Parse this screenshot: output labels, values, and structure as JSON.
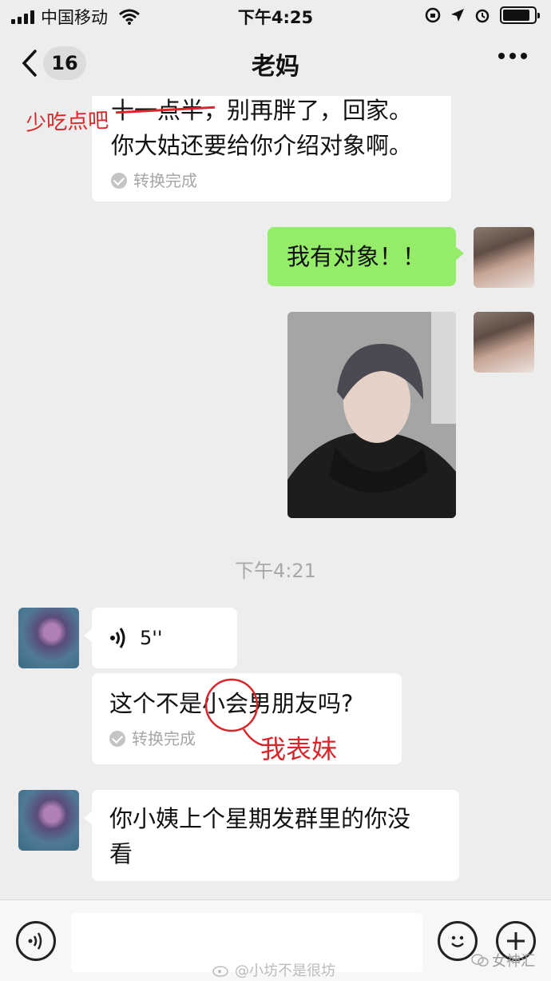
{
  "status_bar": {
    "carrier": "中国移动",
    "time": "下午4:25"
  },
  "nav": {
    "unread_count": "16",
    "title": "老妈"
  },
  "messages": {
    "mom_text_1": {
      "line1": "十一点半，别再胖了，回家。",
      "line2": "你大姑还要给你介绍对象啊。",
      "convert_status": "转换完成"
    },
    "me_text": "我有对象！！",
    "time_divider": "下午4:21",
    "mom_voice_duration": "5''",
    "mom_voice_transcript": {
      "text": "这个不是小会男朋友吗?",
      "convert_status": "转换完成"
    },
    "mom_text_2": {
      "line1": "你小姨上个星期发群里的你没",
      "line2": "看"
    }
  },
  "annotations": {
    "eat_less": "少吃点吧",
    "my_cousin": "我表妹"
  },
  "watermarks": {
    "weibo": "@小坊不是很坊",
    "account": "女神汇"
  },
  "colors": {
    "background": "#ededed",
    "my_bubble": "#95ec69",
    "their_bubble": "#ffffff",
    "annotation_red": "#d9262a"
  }
}
